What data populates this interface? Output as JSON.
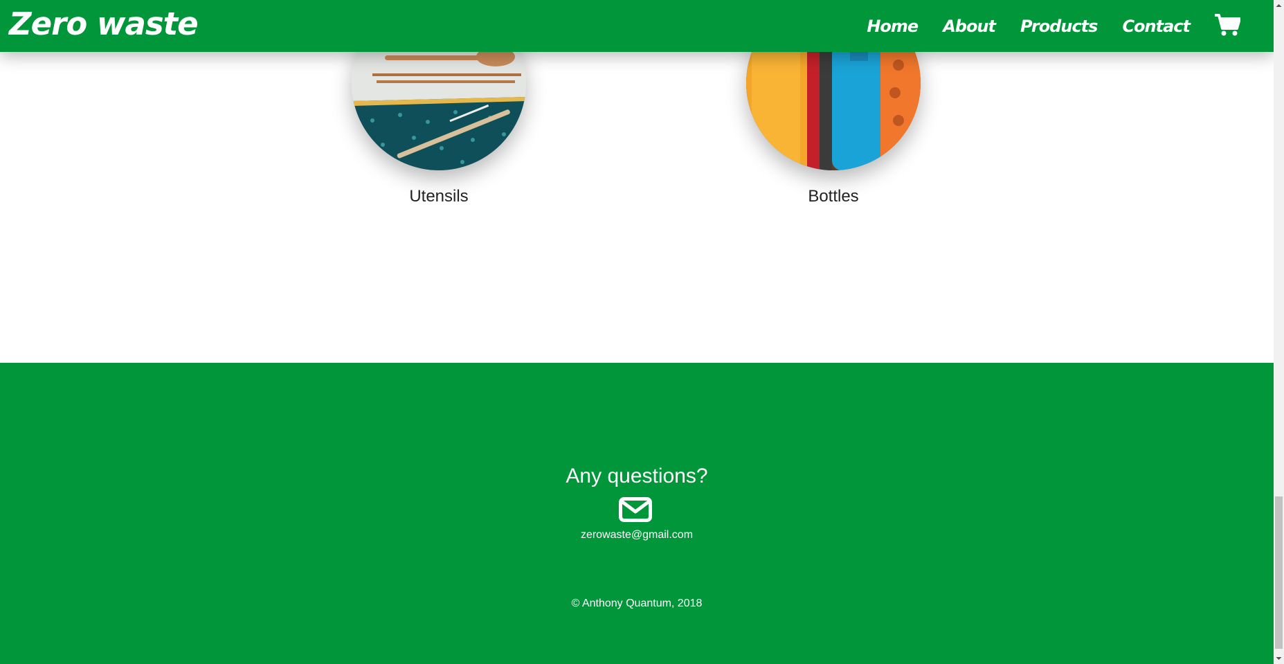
{
  "header": {
    "brand": "Zero waste",
    "nav": [
      {
        "label": "Home"
      },
      {
        "label": "About"
      },
      {
        "label": "Products"
      },
      {
        "label": "Contact"
      }
    ],
    "cart_icon": "shopping-cart-icon"
  },
  "products": [
    {
      "label": "Utensils",
      "image": "utensils-photo"
    },
    {
      "label": "Bottles",
      "image": "bottles-photo"
    }
  ],
  "footer": {
    "question": "Any questions?",
    "mail_icon": "envelope-icon",
    "email": "zerowaste@gmail.com",
    "copyright": "© Anthony Quantum, 2018"
  },
  "colors": {
    "brand_green": "#009639",
    "text_dark": "#222222",
    "white": "#ffffff"
  }
}
